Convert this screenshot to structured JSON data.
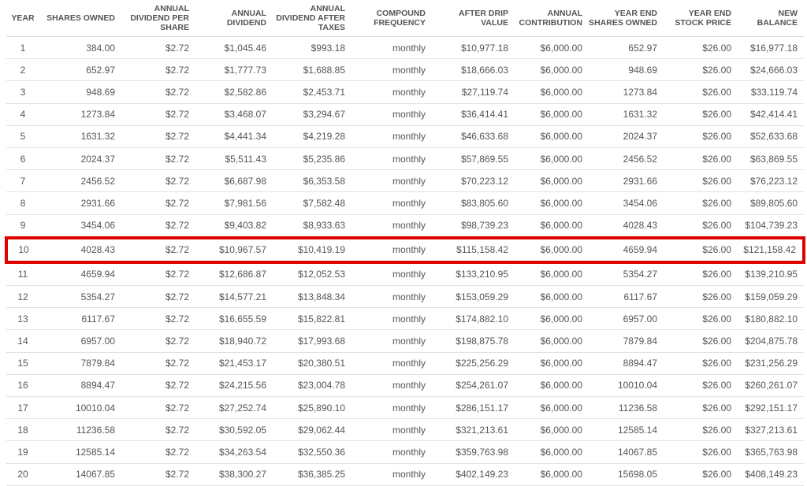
{
  "table": {
    "headers": [
      "YEAR",
      "SHARES OWNED",
      "ANNUAL DIVIDEND PER SHARE",
      "ANNUAL DIVIDEND",
      "ANNUAL DIVIDEND AFTER TAXES",
      "COMPOUND FREQUENCY",
      "AFTER DRIP VALUE",
      "ANNUAL CONTRIBUTION",
      "YEAR END SHARES OWNED",
      "YEAR END STOCK PRICE",
      "NEW BALANCE"
    ],
    "highlighted_row": 10,
    "highlight_color": "#e00000",
    "rows": [
      [
        "1",
        "384.00",
        "$2.72",
        "$1,045.46",
        "$993.18",
        "monthly",
        "$10,977.18",
        "$6,000.00",
        "652.97",
        "$26.00",
        "$16,977.18"
      ],
      [
        "2",
        "652.97",
        "$2.72",
        "$1,777.73",
        "$1,688.85",
        "monthly",
        "$18,666.03",
        "$6,000.00",
        "948.69",
        "$26.00",
        "$24,666.03"
      ],
      [
        "3",
        "948.69",
        "$2.72",
        "$2,582.86",
        "$2,453.71",
        "monthly",
        "$27,119.74",
        "$6,000.00",
        "1273.84",
        "$26.00",
        "$33,119.74"
      ],
      [
        "4",
        "1273.84",
        "$2.72",
        "$3,468.07",
        "$3,294.67",
        "monthly",
        "$36,414.41",
        "$6,000.00",
        "1631.32",
        "$26.00",
        "$42,414.41"
      ],
      [
        "5",
        "1631.32",
        "$2.72",
        "$4,441.34",
        "$4,219.28",
        "monthly",
        "$46,633.68",
        "$6,000.00",
        "2024.37",
        "$26.00",
        "$52,633.68"
      ],
      [
        "6",
        "2024.37",
        "$2.72",
        "$5,511.43",
        "$5,235.86",
        "monthly",
        "$57,869.55",
        "$6,000.00",
        "2456.52",
        "$26.00",
        "$63,869.55"
      ],
      [
        "7",
        "2456.52",
        "$2.72",
        "$6,687.98",
        "$6,353.58",
        "monthly",
        "$70,223.12",
        "$6,000.00",
        "2931.66",
        "$26.00",
        "$76,223.12"
      ],
      [
        "8",
        "2931.66",
        "$2.72",
        "$7,981.56",
        "$7,582.48",
        "monthly",
        "$83,805.60",
        "$6,000.00",
        "3454.06",
        "$26.00",
        "$89,805.60"
      ],
      [
        "9",
        "3454.06",
        "$2.72",
        "$9,403.82",
        "$8,933.63",
        "monthly",
        "$98,739.23",
        "$6,000.00",
        "4028.43",
        "$26.00",
        "$104,739.23"
      ],
      [
        "10",
        "4028.43",
        "$2.72",
        "$10,967.57",
        "$10,419.19",
        "monthly",
        "$115,158.42",
        "$6,000.00",
        "4659.94",
        "$26.00",
        "$121,158.42"
      ],
      [
        "11",
        "4659.94",
        "$2.72",
        "$12,686.87",
        "$12,052.53",
        "monthly",
        "$133,210.95",
        "$6,000.00",
        "5354.27",
        "$26.00",
        "$139,210.95"
      ],
      [
        "12",
        "5354.27",
        "$2.72",
        "$14,577.21",
        "$13,848.34",
        "monthly",
        "$153,059.29",
        "$6,000.00",
        "6117.67",
        "$26.00",
        "$159,059.29"
      ],
      [
        "13",
        "6117.67",
        "$2.72",
        "$16,655.59",
        "$15,822.81",
        "monthly",
        "$174,882.10",
        "$6,000.00",
        "6957.00",
        "$26.00",
        "$180,882.10"
      ],
      [
        "14",
        "6957.00",
        "$2.72",
        "$18,940.72",
        "$17,993.68",
        "monthly",
        "$198,875.78",
        "$6,000.00",
        "7879.84",
        "$26.00",
        "$204,875.78"
      ],
      [
        "15",
        "7879.84",
        "$2.72",
        "$21,453.17",
        "$20,380.51",
        "monthly",
        "$225,256.29",
        "$6,000.00",
        "8894.47",
        "$26.00",
        "$231,256.29"
      ],
      [
        "16",
        "8894.47",
        "$2.72",
        "$24,215.56",
        "$23,004.78",
        "monthly",
        "$254,261.07",
        "$6,000.00",
        "10010.04",
        "$26.00",
        "$260,261.07"
      ],
      [
        "17",
        "10010.04",
        "$2.72",
        "$27,252.74",
        "$25,890.10",
        "monthly",
        "$286,151.17",
        "$6,000.00",
        "11236.58",
        "$26.00",
        "$292,151.17"
      ],
      [
        "18",
        "11236.58",
        "$2.72",
        "$30,592.05",
        "$29,062.44",
        "monthly",
        "$321,213.61",
        "$6,000.00",
        "12585.14",
        "$26.00",
        "$327,213.61"
      ],
      [
        "19",
        "12585.14",
        "$2.72",
        "$34,263.54",
        "$32,550.36",
        "monthly",
        "$359,763.98",
        "$6,000.00",
        "14067.85",
        "$26.00",
        "$365,763.98"
      ],
      [
        "20",
        "14067.85",
        "$2.72",
        "$38,300.27",
        "$36,385.25",
        "monthly",
        "$402,149.23",
        "$6,000.00",
        "15698.05",
        "$26.00",
        "$408,149.23"
      ]
    ]
  }
}
